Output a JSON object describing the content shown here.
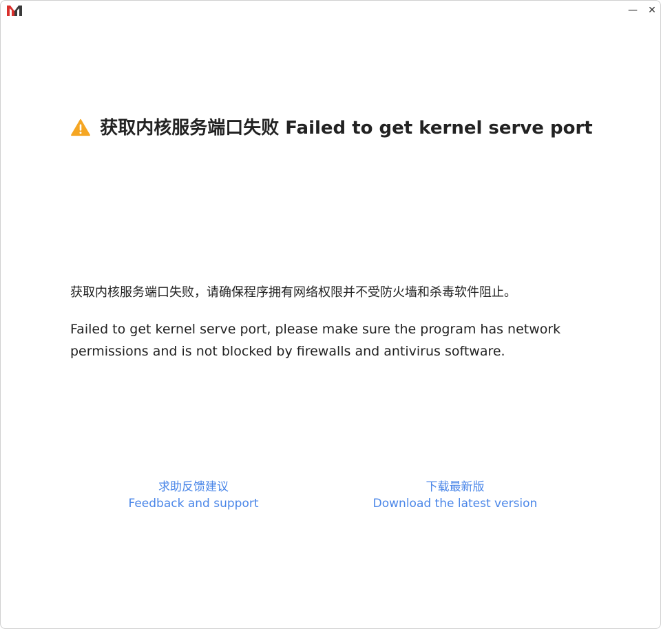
{
  "window": {
    "minimize_symbol": "—",
    "close_symbol": "✕",
    "logo_icon": "app-logo-icon"
  },
  "error": {
    "icon": "warning-icon",
    "title": "获取内核服务端口失败 Failed to get kernel serve port",
    "message_cn": "获取内核服务端口失败，请确保程序拥有网络权限并不受防火墙和杀毒软件阻止。",
    "message_en": "Failed to get kernel serve port, please make sure the program has network permissions and is not blocked by firewalls and antivirus software."
  },
  "links": {
    "feedback_cn": "求助反馈建议",
    "feedback_en": "Feedback and support",
    "download_cn": "下载最新版",
    "download_en": "Download the latest version"
  },
  "colors": {
    "link": "#4a86e8",
    "warning": "#f5a623",
    "logo_red": "#d9302c",
    "logo_dark": "#3a3a3a"
  }
}
